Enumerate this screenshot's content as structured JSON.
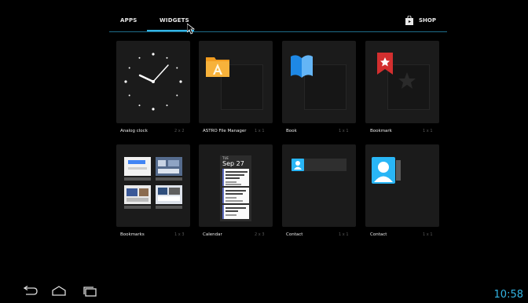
{
  "tabs": {
    "apps": "APPS",
    "widgets": "WIDGETS",
    "shop": "SHOP"
  },
  "widgets": [
    {
      "name": "Analog clock",
      "size": "2 x 2"
    },
    {
      "name": "ASTRO File Manager",
      "size": "1 x 1"
    },
    {
      "name": "Book",
      "size": "1 x 1"
    },
    {
      "name": "Bookmark",
      "size": "1 x 1"
    },
    {
      "name": "Bookmarks",
      "size": "1 x 3"
    },
    {
      "name": "Calendar",
      "size": "2 x 3"
    },
    {
      "name": "Contact",
      "size": "1 x 1"
    },
    {
      "name": "Contact",
      "size": "1 x 1"
    }
  ],
  "calendar_preview": {
    "day": "TUE",
    "date": "Sep 27"
  },
  "status": {
    "time": "10:58"
  },
  "colors": {
    "accent": "#33b5e5",
    "background": "#000000",
    "card": "#1b1b1b"
  }
}
